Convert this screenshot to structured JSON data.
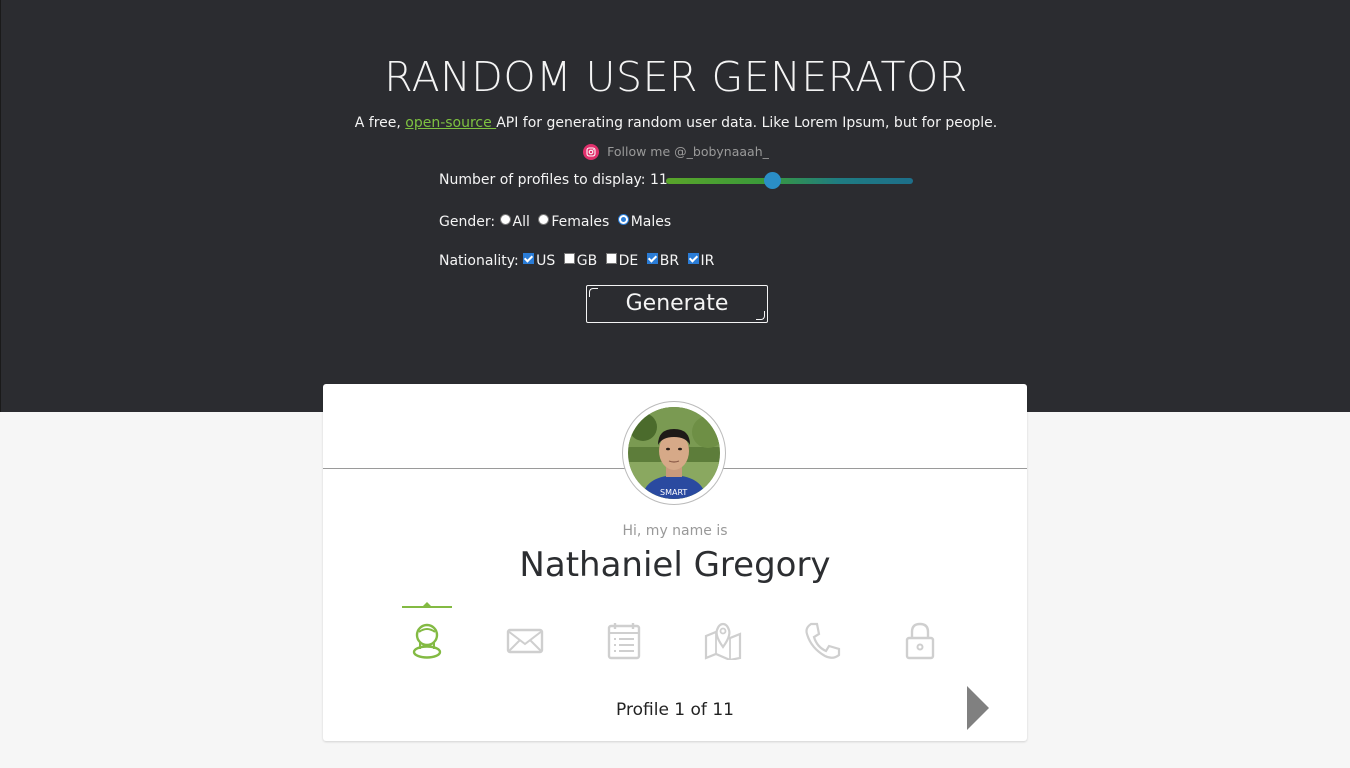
{
  "header": {
    "title": "RANDOM USER GENERATOR",
    "subtitle_before": "A free, ",
    "subtitle_link": "open-source ",
    "subtitle_after": "API for generating random user data. Like Lorem Ipsum, but for people.",
    "follow_text": "Follow me @_bobynaaah_"
  },
  "controls": {
    "profiles_label": "Number of profiles to display: 11",
    "profiles_value": 11,
    "profiles_slider_fraction": 0.43,
    "gender_label": "Gender:",
    "gender_options": [
      "All",
      "Females",
      "Males"
    ],
    "gender_selected": "Males",
    "nationality_label": "Nationality:",
    "nationalities": [
      {
        "code": "US",
        "checked": true
      },
      {
        "code": "GB",
        "checked": false
      },
      {
        "code": "DE",
        "checked": false
      },
      {
        "code": "BR",
        "checked": true
      },
      {
        "code": "IR",
        "checked": true
      }
    ],
    "generate_label": "Generate"
  },
  "card": {
    "greeting": "Hi, my name is",
    "name": "Nathaniel Gregory",
    "tabs": [
      {
        "icon": "user-icon",
        "active": true
      },
      {
        "icon": "mail-icon",
        "active": false
      },
      {
        "icon": "calendar-icon",
        "active": false
      },
      {
        "icon": "map-icon",
        "active": false
      },
      {
        "icon": "phone-icon",
        "active": false
      },
      {
        "icon": "lock-icon",
        "active": false
      }
    ],
    "profile_count": "Profile 1 of 11"
  },
  "colors": {
    "hero_bg": "#2b2c30",
    "accent_green": "#83ba43",
    "link_green": "#7ec241",
    "icon_gray": "#cfcfcf"
  }
}
